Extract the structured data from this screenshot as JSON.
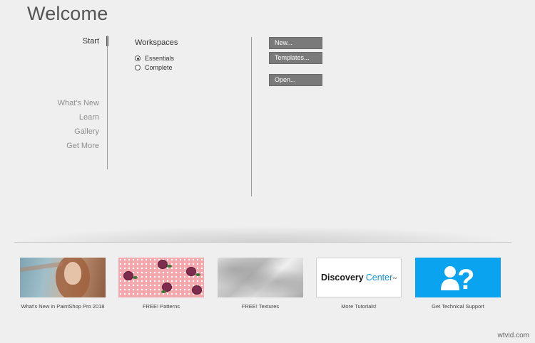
{
  "header": {
    "title": "Welcome"
  },
  "nav": {
    "start": "Start",
    "items": [
      "What's New",
      "Learn",
      "Gallery",
      "Get More"
    ]
  },
  "workspaces": {
    "heading": "Workspaces",
    "options": [
      {
        "label": "Essentials",
        "selected": true
      },
      {
        "label": "Complete",
        "selected": false
      }
    ]
  },
  "actions": {
    "new_label": "New...",
    "templates_label": "Templates...",
    "open_label": "Open..."
  },
  "tiles": [
    {
      "label": "What's New in PaintShop Pro 2018",
      "icon": "portrait-image"
    },
    {
      "label": "FREE! Patterns",
      "icon": "rose-pattern-image"
    },
    {
      "label": "FREE! Textures",
      "icon": "marble-texture-image"
    },
    {
      "label": "More Tutorials!",
      "icon": "discovery-center-logo",
      "logo_word1": "Discovery",
      "logo_word2": "Center",
      "logo_tm": "TM"
    },
    {
      "label": "Get Technical Support",
      "icon": "support-person-question-icon"
    }
  ],
  "watermark": "wtvid.com",
  "colors": {
    "button": "#7a7a7a",
    "support_blue": "#0aa3f0",
    "discovery_blue": "#0e93d8",
    "pattern_pink": "#f2a8ad"
  }
}
